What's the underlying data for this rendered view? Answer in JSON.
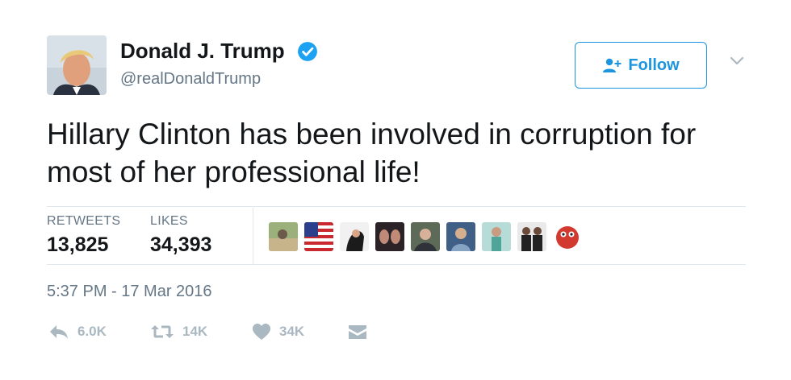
{
  "author": {
    "name": "Donald J. Trump",
    "handle": "@realDonaldTrump",
    "verified": true
  },
  "follow_label": "Follow",
  "tweet_text": "Hillary Clinton has been involved in corruption for most of her professional life!",
  "stats": {
    "retweets_label": "RETWEETS",
    "retweets_count": "13,825",
    "likes_label": "LIKES",
    "likes_count": "34,393"
  },
  "timestamp": "5:37 PM - 17 Mar 2016",
  "actions": {
    "reply_count": "6.0K",
    "retweet_count": "14K",
    "like_count": "34K"
  },
  "colors": {
    "accent": "#1b95e0",
    "muted": "#657786",
    "action_gray": "#aab8c2",
    "divider": "#e1e8ed"
  },
  "icons": [
    "verified-badge-icon",
    "follow-person-icon",
    "chevron-down-icon",
    "reply-icon",
    "retweet-icon",
    "heart-icon",
    "direct-message-icon"
  ]
}
